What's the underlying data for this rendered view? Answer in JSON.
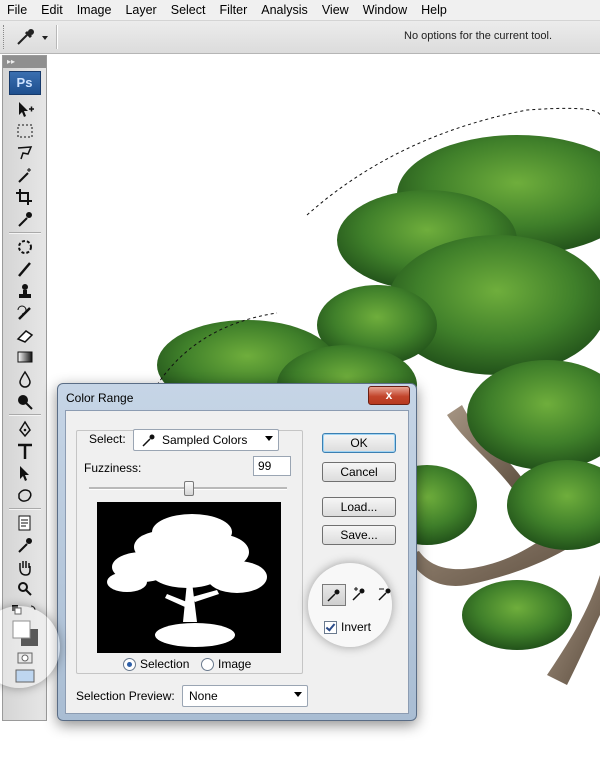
{
  "menu": [
    "File",
    "Edit",
    "Image",
    "Layer",
    "Select",
    "Filter",
    "Analysis",
    "View",
    "Window",
    "Help"
  ],
  "options_bar": {
    "message": "No options for the current tool."
  },
  "toolbox": {
    "logo": "Ps"
  },
  "dialog": {
    "title": "Color Range",
    "close_label": "x",
    "select_label": "Select:",
    "select_value": "Sampled Colors",
    "fuzziness_label": "Fuzziness:",
    "fuzziness_value": "99",
    "radio_selection": "Selection",
    "radio_image": "Image",
    "selected_radio": "Selection",
    "preview_label": "Selection Preview:",
    "preview_value": "None",
    "ok_label": "OK",
    "cancel_label": "Cancel",
    "load_label": "Load...",
    "save_label": "Save...",
    "invert_label": "Invert",
    "invert_checked": true
  },
  "colors": {
    "foliage": "#3f7f2a",
    "trunk": "#7a6a58",
    "title_bar": "#b8c9dc",
    "close_red": "#c2452c"
  }
}
